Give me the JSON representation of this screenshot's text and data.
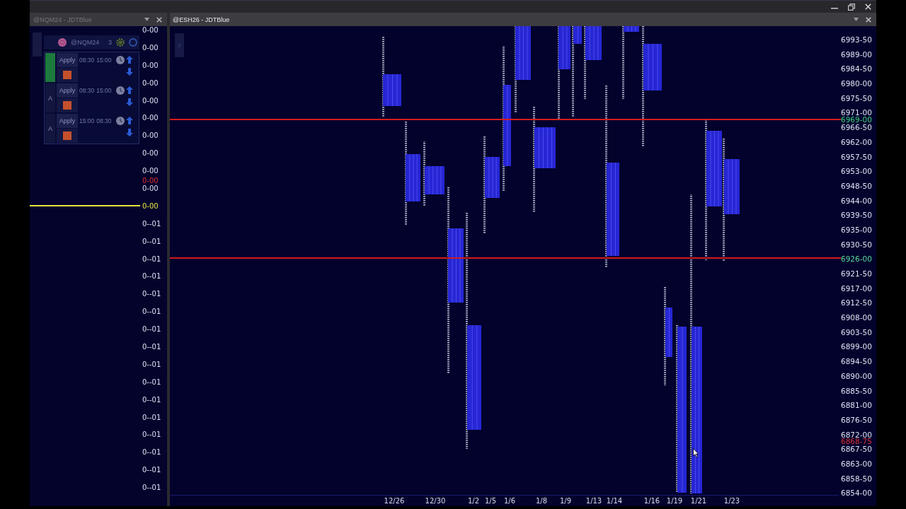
{
  "left_pane": {
    "title": "@NQM24 - JDTBlue",
    "active": false,
    "tool": {
      "symbol": "@NQM24",
      "count": "3",
      "rows": [
        {
          "active": true,
          "button": "Apply",
          "start": "08:30",
          "end": "15:00"
        },
        {
          "active": false,
          "label": "A",
          "button": "Apply",
          "start": "08:30",
          "end": "15:00"
        },
        {
          "active": false,
          "label": "A",
          "button": "Apply",
          "start": "15:00",
          "end": "08:30"
        }
      ]
    },
    "scale": [
      {
        "text": "0-00",
        "kind": "tick"
      },
      {
        "text": "0-00",
        "kind": "tick"
      },
      {
        "text": "0-00",
        "kind": "tick"
      },
      {
        "text": "0-00",
        "kind": "tick"
      },
      {
        "text": "0-00",
        "kind": "tick"
      },
      {
        "text": "0-00",
        "kind": "tick"
      },
      {
        "text": "0-00",
        "kind": "tick"
      },
      {
        "text": "0-00",
        "kind": "tick"
      },
      {
        "text": "0-00",
        "kind": "tick"
      },
      {
        "text": "0-00",
        "kind": "marker",
        "color": "#e03030",
        "line": false
      },
      {
        "text": "0-00",
        "kind": "tick"
      },
      {
        "text": "0-00",
        "kind": "level",
        "color": "#e6e63c",
        "line": true
      },
      {
        "text": "0--01",
        "kind": "tick"
      },
      {
        "text": "0--01",
        "kind": "tick"
      },
      {
        "text": "0--01",
        "kind": "tick"
      },
      {
        "text": "0--01",
        "kind": "tick"
      },
      {
        "text": "0--01",
        "kind": "tick"
      },
      {
        "text": "0--01",
        "kind": "tick"
      },
      {
        "text": "0--01",
        "kind": "tick"
      },
      {
        "text": "0--01",
        "kind": "tick"
      },
      {
        "text": "0--01",
        "kind": "tick"
      },
      {
        "text": "0--01",
        "kind": "tick"
      },
      {
        "text": "0--01",
        "kind": "tick"
      },
      {
        "text": "0--01",
        "kind": "tick"
      },
      {
        "text": "0--01",
        "kind": "tick"
      },
      {
        "text": "0--01",
        "kind": "tick"
      },
      {
        "text": "0--01",
        "kind": "tick"
      },
      {
        "text": "0--01",
        "kind": "tick"
      }
    ]
  },
  "chart_pane": {
    "title": "@ESH26 - JDTBlue",
    "active": true,
    "price_scale": [
      {
        "text": "6993-50",
        "kind": "tick"
      },
      {
        "text": "6989-00",
        "kind": "tick"
      },
      {
        "text": "6984-50",
        "kind": "tick"
      },
      {
        "text": "6980-00",
        "kind": "tick"
      },
      {
        "text": "6975-50",
        "kind": "tick"
      },
      {
        "text": "6971-00",
        "kind": "tick"
      },
      {
        "text": "6969-00",
        "kind": "marker",
        "color": "#3ed07e",
        "line": true
      },
      {
        "text": "6966-50",
        "kind": "tick"
      },
      {
        "text": "6962-00",
        "kind": "tick"
      },
      {
        "text": "6957-50",
        "kind": "tick"
      },
      {
        "text": "6953-00",
        "kind": "tick"
      },
      {
        "text": "6948-50",
        "kind": "tick"
      },
      {
        "text": "6944-00",
        "kind": "tick"
      },
      {
        "text": "6939-50",
        "kind": "tick"
      },
      {
        "text": "6935-00",
        "kind": "tick"
      },
      {
        "text": "6930-50",
        "kind": "tick"
      },
      {
        "text": "6926-00",
        "kind": "level",
        "color": "#5ed89c",
        "line": true
      },
      {
        "text": "6921-50",
        "kind": "tick"
      },
      {
        "text": "6917-00",
        "kind": "tick"
      },
      {
        "text": "6912-50",
        "kind": "tick"
      },
      {
        "text": "6908-00",
        "kind": "tick"
      },
      {
        "text": "6903-50",
        "kind": "tick"
      },
      {
        "text": "6899-00",
        "kind": "tick"
      },
      {
        "text": "6894-50",
        "kind": "tick"
      },
      {
        "text": "6890-00",
        "kind": "tick"
      },
      {
        "text": "6885-50",
        "kind": "tick"
      },
      {
        "text": "6881-00",
        "kind": "tick"
      },
      {
        "text": "6876-50",
        "kind": "tick"
      },
      {
        "text": "6872-00",
        "kind": "tick"
      },
      {
        "text": "6868-75",
        "kind": "marker",
        "color": "#d83232",
        "line": false
      },
      {
        "text": "6867-50",
        "kind": "tick"
      },
      {
        "text": "6863-00",
        "kind": "tick"
      },
      {
        "text": "6858-50",
        "kind": "tick"
      },
      {
        "text": "6854-00",
        "kind": "tick"
      }
    ],
    "dates": [
      "12/26",
      "12/30",
      "1/2",
      "1/5",
      "1/6",
      "1/8",
      "1/9",
      "1/13",
      "1/14",
      "1/16",
      "1/19",
      "1/21",
      "1/23"
    ]
  }
}
